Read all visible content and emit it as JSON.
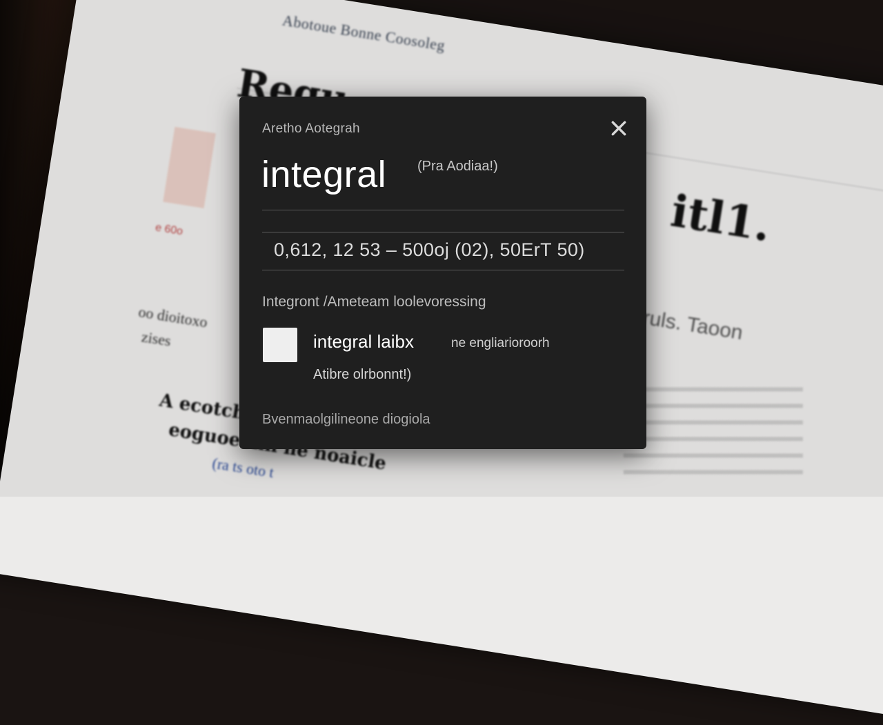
{
  "background": {
    "top_line": "Abotoue Bonne Coosoleg",
    "title_left": "Regu",
    "title_right": "itl1.",
    "note_right": "eoruls. Taoon",
    "red_note": "e 60o",
    "side_text_1": "oo dioitoxo",
    "side_text_2": "zises",
    "bottom_text_1": "A ecotch ra atos",
    "bottom_text_2": "eoguoeonn ne noaicle",
    "bottom_link": "(ra ts oto t"
  },
  "modal": {
    "eyebrow": "Aretho Aotegrah",
    "title": "integral",
    "title_sub": "(Pra Aodiaa!)",
    "formula": "0,612, 12 53 – 500oj (02), 50ErT 50)",
    "section_label": "Integront /Ameteam loolevoressing",
    "checkbox_label": "integral laibx",
    "checkbox_hint": "ne engliarioroorh",
    "checkbox_sub": "Atibre olrbonnt!)",
    "footer_link": "Bvenmaolgilineone diogiola",
    "close_icon": "close-icon"
  },
  "colors": {
    "modal_bg": "#1f1f1f",
    "page_bg": "#ecebea",
    "checkbox": "#eeeeee"
  }
}
